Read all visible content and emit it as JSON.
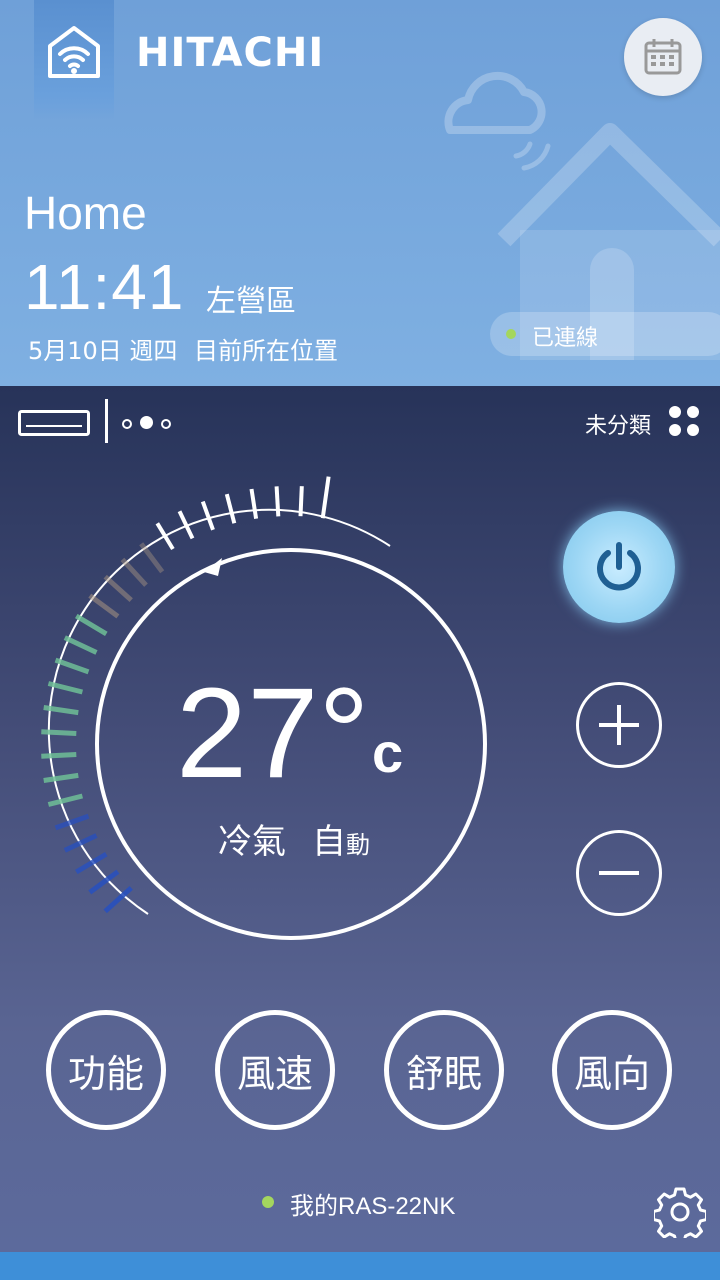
{
  "header": {
    "brand": "HITACHI",
    "title": "Home",
    "time": "11:41",
    "district": "左營區",
    "date": "5月10日 週四",
    "location_label": "目前所在位置",
    "connection_status": "已連線"
  },
  "toolbar": {
    "category": "未分類",
    "page_count": 3,
    "active_page": 2
  },
  "thermostat": {
    "temperature": "27°",
    "unit": "c",
    "mode": "冷氣",
    "fan_mode_main": "自",
    "fan_mode_small": "動"
  },
  "functions": [
    {
      "label": "功能"
    },
    {
      "label": "風速"
    },
    {
      "label": "舒眠"
    },
    {
      "label": "風向"
    }
  ],
  "device": {
    "name": "我的RAS-22NK"
  },
  "icons": [
    "wifi-home-icon",
    "calendar-icon",
    "ac-unit-icon",
    "grid-icon",
    "power-icon",
    "plus-icon",
    "minus-icon",
    "gear-icon"
  ],
  "colors": {
    "accent": "#a4d65e",
    "header_bg": "#7fb0e2",
    "power_btn": "#9cd6f4"
  }
}
